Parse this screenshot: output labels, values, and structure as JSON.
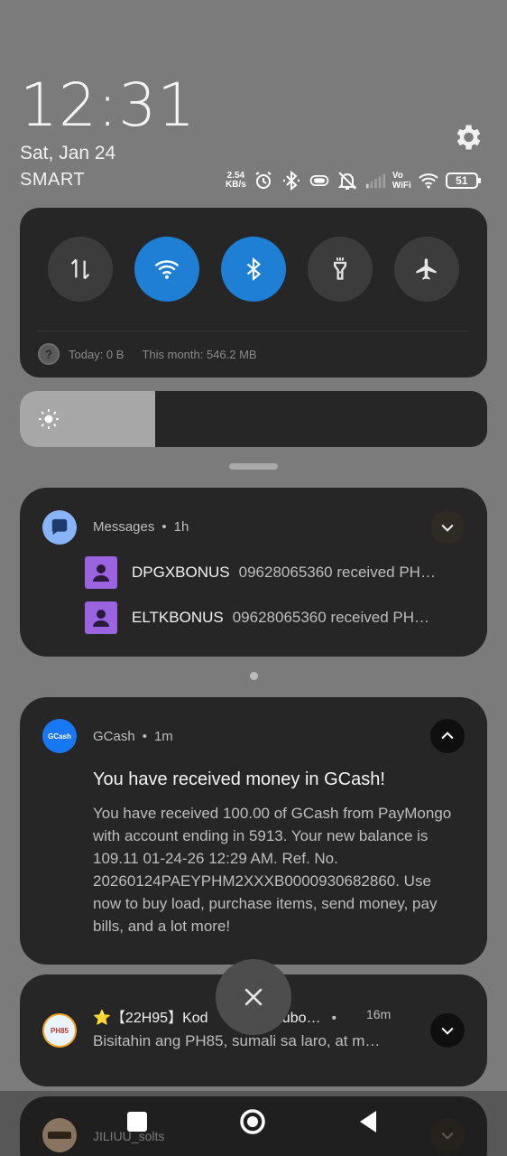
{
  "status": {
    "time": "12:31",
    "date": "Sat, Jan 24",
    "carrier": "SMART",
    "net_speed_value": "2.54",
    "net_speed_unit": "KB/s",
    "vowifi_top": "Vo",
    "vowifi_bottom": "WiFi",
    "battery": "51"
  },
  "quick_settings": {
    "toggles": [
      {
        "name": "mobile-data",
        "state": "off"
      },
      {
        "name": "wifi",
        "state": "on"
      },
      {
        "name": "bluetooth",
        "state": "on"
      },
      {
        "name": "flashlight",
        "state": "off"
      },
      {
        "name": "airplane-mode",
        "state": "off"
      }
    ],
    "data_today": "Today: 0 B",
    "data_month": "This month: 546.2 MB",
    "brightness_level": 0.29
  },
  "notifications": {
    "messages": {
      "app": "Messages",
      "age": "1h",
      "items": [
        {
          "sender": "DPGXBONUS",
          "preview": "09628065360 received PH…"
        },
        {
          "sender": "ELTKBONUS",
          "preview": "09628065360 received PH…"
        }
      ]
    },
    "gcash": {
      "app": "GCash",
      "icon_text": "GCash",
      "age": "1m",
      "title": "You have received money in GCash!",
      "body": "You have received 100.00 of GCash from PayMongo with account ending in 5913. Your new balance is 109.11 01-24-26 12:29 AM. Ref. No. 20260124PAEYPHM2XXXB0000930682860. Use now to buy load, purchase items, send money, pay bills, and a lot more!"
    },
    "game": {
      "title": "⭐【22H95】Kod",
      "title_after": "agtubo…",
      "age": "16m",
      "icon_text": "PH85",
      "body": "Bisitahin ang PH85, sumali sa laro, at m…"
    },
    "jili": {
      "app": "JILIUU_solts"
    }
  },
  "colors": {
    "panel": "#262626",
    "accent_on": "#1e7fd4",
    "background": "#7b7b7b"
  }
}
